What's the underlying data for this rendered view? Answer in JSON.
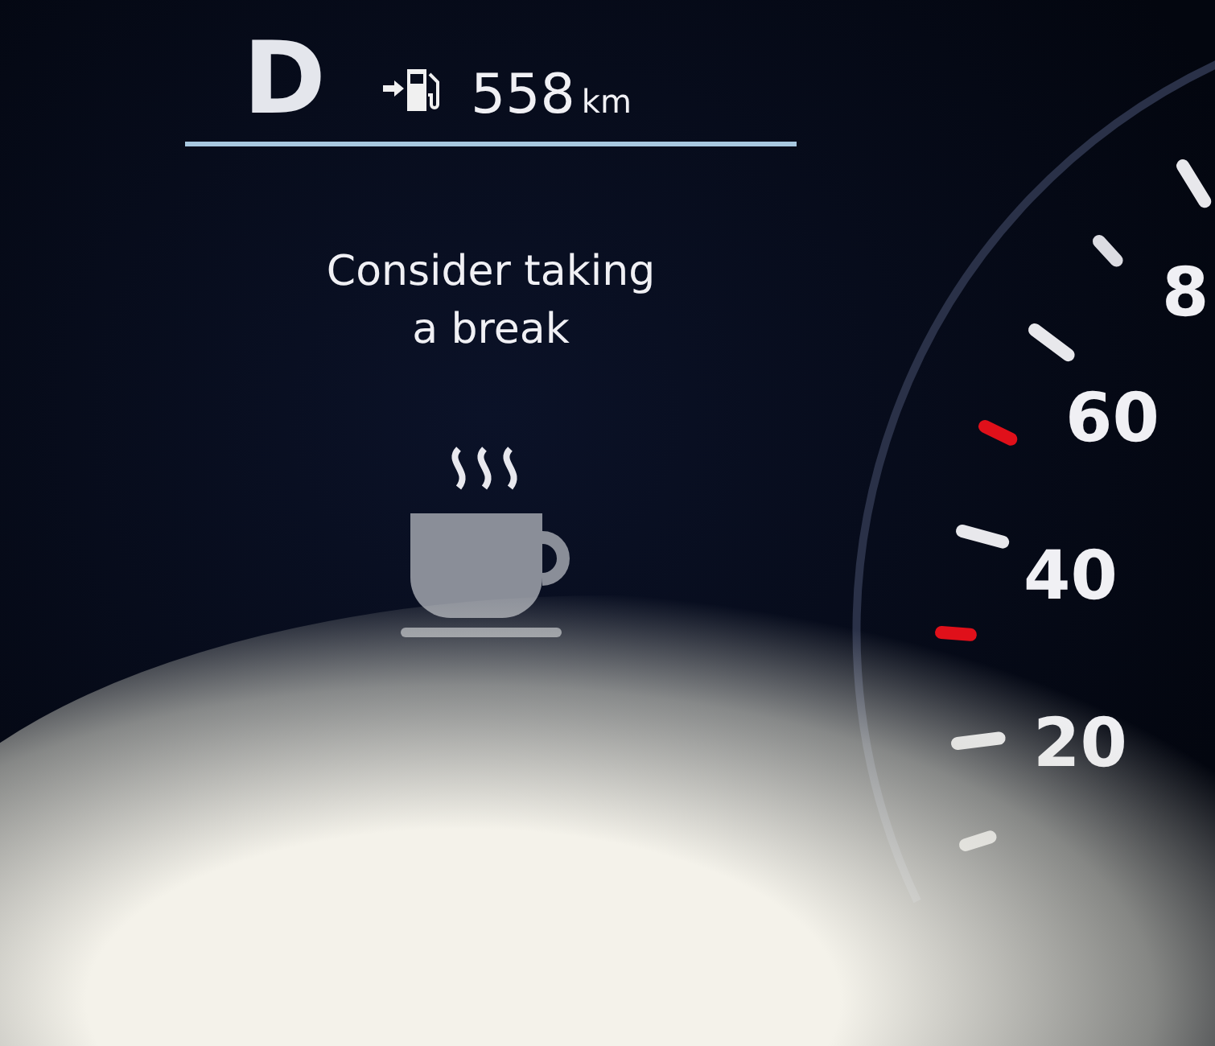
{
  "status": {
    "gear": "D",
    "range_value": "558",
    "range_unit": "km"
  },
  "alert": {
    "message": "Consider taking a break"
  },
  "speedometer": {
    "labels": [
      "8",
      "60",
      "40",
      "20"
    ]
  }
}
